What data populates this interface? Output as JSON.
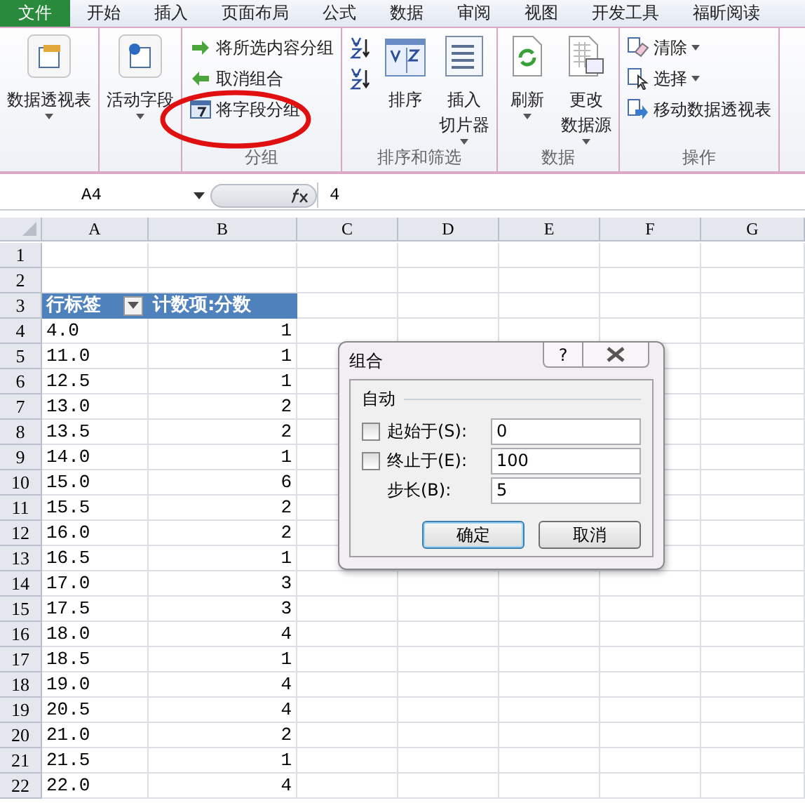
{
  "tabs": [
    {
      "label": "文件",
      "kind": "file"
    },
    {
      "label": "开始",
      "kind": "tab"
    },
    {
      "label": "插入",
      "kind": "tab"
    },
    {
      "label": "页面布局",
      "kind": "tab"
    },
    {
      "label": "公式",
      "kind": "tab"
    },
    {
      "label": "数据",
      "kind": "tab"
    },
    {
      "label": "审阅",
      "kind": "tab"
    },
    {
      "label": "视图",
      "kind": "tab"
    },
    {
      "label": "开发工具",
      "kind": "tab"
    },
    {
      "label": "福昕阅读",
      "kind": "tab"
    }
  ],
  "ribbon": [
    {
      "items": [
        {
          "kind": "pivot",
          "lines": [
            "数据透视表"
          ],
          "dropdown": true
        }
      ]
    },
    {
      "items": [
        {
          "kind": "field",
          "lines": [
            "活动字段"
          ],
          "dropdown": true
        }
      ]
    },
    {
      "label": "分组",
      "items": [
        {
          "kind": "group",
          "label": "将所选内容分组"
        },
        {
          "kind": "ungroup",
          "label": "取消组合"
        },
        {
          "kind": "groupfield",
          "label": "将字段分组"
        }
      ]
    },
    {
      "label": "排序和筛选",
      "items": [
        {
          "kind": "sortaz"
        },
        {
          "kind": "sortza"
        },
        {
          "kind": "sort",
          "lines": [
            "排序"
          ],
          "dropdown": false
        },
        {
          "kind": "slicer",
          "lines": [
            "插入",
            "切片器"
          ],
          "dropdown": true
        }
      ]
    },
    {
      "label": "数据",
      "items": [
        {
          "kind": "refresh",
          "lines": [
            "刷新"
          ],
          "dropdown": true
        },
        {
          "kind": "source",
          "lines": [
            "更改",
            "数据源"
          ],
          "dropdown": true
        }
      ]
    },
    {
      "label": "操作",
      "items": [
        {
          "kind": "clear",
          "label": "清除",
          "dropdown": true
        },
        {
          "kind": "select",
          "label": "选择",
          "dropdown": true
        },
        {
          "kind": "move",
          "label": "移动数据透视表"
        }
      ]
    }
  ],
  "formula_bar": {
    "name_box": "A4",
    "value": "4"
  },
  "sheet": {
    "columns": [
      "A",
      "B",
      "C",
      "D",
      "E",
      "F",
      "G"
    ],
    "rows": [
      {
        "number": "1",
        "kind": "empty"
      },
      {
        "number": "2",
        "kind": "empty"
      },
      {
        "number": "3",
        "kind": "header",
        "label": "行标签",
        "count": "计数项:分数"
      },
      {
        "number": "4",
        "kind": "data",
        "label": "4.0",
        "count": "1"
      },
      {
        "number": "5",
        "kind": "data",
        "label": "11.0",
        "count": "1"
      },
      {
        "number": "6",
        "kind": "data",
        "label": "12.5",
        "count": "1"
      },
      {
        "number": "7",
        "kind": "data",
        "label": "13.0",
        "count": "2"
      },
      {
        "number": "8",
        "kind": "data",
        "label": "13.5",
        "count": "2"
      },
      {
        "number": "9",
        "kind": "data",
        "label": "14.0",
        "count": "1"
      },
      {
        "number": "10",
        "kind": "data",
        "label": "15.0",
        "count": "6"
      },
      {
        "number": "11",
        "kind": "data",
        "label": "15.5",
        "count": "2"
      },
      {
        "number": "12",
        "kind": "data",
        "label": "16.0",
        "count": "2"
      },
      {
        "number": "13",
        "kind": "data",
        "label": "16.5",
        "count": "1"
      },
      {
        "number": "14",
        "kind": "data",
        "label": "17.0",
        "count": "3"
      },
      {
        "number": "15",
        "kind": "data",
        "label": "17.5",
        "count": "3"
      },
      {
        "number": "16",
        "kind": "data",
        "label": "18.0",
        "count": "4"
      },
      {
        "number": "17",
        "kind": "data",
        "label": "18.5",
        "count": "1"
      },
      {
        "number": "18",
        "kind": "data",
        "label": "19.0",
        "count": "4"
      },
      {
        "number": "19",
        "kind": "data",
        "label": "20.5",
        "count": "4"
      },
      {
        "number": "20",
        "kind": "data",
        "label": "21.0",
        "count": "2"
      },
      {
        "number": "21",
        "kind": "data",
        "label": "21.5",
        "count": "1"
      },
      {
        "number": "22",
        "kind": "data",
        "label": "22.0",
        "count": "4"
      }
    ]
  },
  "dialog": {
    "title": "组合",
    "help": "?",
    "section": "自动",
    "fields": [
      {
        "label": "起始于(S):",
        "has_checkbox": true,
        "checked": false,
        "value": "0"
      },
      {
        "label": "终止于(E):",
        "has_checkbox": true,
        "checked": false,
        "value": "100"
      },
      {
        "label": "步长(B):",
        "has_checkbox": false,
        "value": "5"
      }
    ],
    "buttons": [
      {
        "label": "确定",
        "default": true
      },
      {
        "label": "取消",
        "default": false
      }
    ]
  }
}
